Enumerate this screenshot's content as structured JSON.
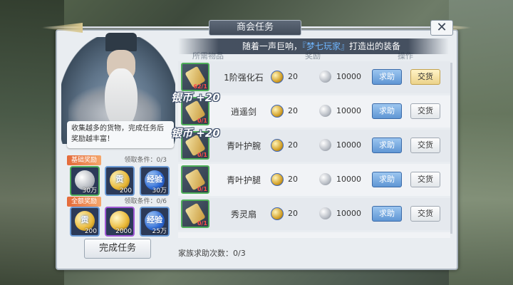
{
  "window": {
    "title": "商会任务",
    "close_label": "✕"
  },
  "announcement": {
    "prefix": "随着一声巨响，",
    "name": "『梦七玩家』",
    "suffix": "打造出的装备"
  },
  "table_headers": {
    "item": "所需物品",
    "reward": "奖励",
    "action": "操作"
  },
  "npc": {
    "speech": "收集越多的货物，完成任务后奖励越丰富！"
  },
  "basic_reward": {
    "tag": "基础奖励",
    "condition": "领取条件：0/3",
    "items": [
      {
        "icon": "silver-coin-icon",
        "label": "30万",
        "inner": ""
      },
      {
        "icon": "contribution-icon",
        "label": "200",
        "inner": "贡"
      },
      {
        "icon": "experience-icon",
        "label": "30万",
        "inner": "经验"
      }
    ]
  },
  "full_reward": {
    "tag": "全额奖励",
    "condition": "领取条件：0/6",
    "items": [
      {
        "icon": "contribution-icon",
        "label": "200",
        "inner": "贡"
      },
      {
        "icon": "gold-coin-icon",
        "label": "2000",
        "inner": ""
      },
      {
        "icon": "experience-icon",
        "label": "25万",
        "inner": "经验"
      }
    ]
  },
  "tasks": [
    {
      "name": "1阶强化石",
      "count": "62/1",
      "contribution": "20",
      "silver": "10000",
      "help": "求助",
      "give": "交货",
      "give_highlight": true
    },
    {
      "name": "逍遥剑",
      "count": "0/1",
      "contribution": "20",
      "silver": "10000",
      "help": "求助",
      "give": "交货",
      "give_highlight": false
    },
    {
      "name": "青叶护腕",
      "count": "0/1",
      "contribution": "20",
      "silver": "10000",
      "help": "求助",
      "give": "交货",
      "give_highlight": false
    },
    {
      "name": "青叶护腿",
      "count": "0/1",
      "contribution": "20",
      "silver": "10000",
      "help": "求助",
      "give": "交货",
      "give_highlight": false
    },
    {
      "name": "秀灵扇",
      "count": "0/1",
      "contribution": "20",
      "silver": "10000",
      "help": "求助",
      "give": "交货",
      "give_highlight": false
    }
  ],
  "floating_texts": [
    "银币 +20",
    "银币 +20"
  ],
  "complete_button": "完成任务",
  "family_help": "家族求助次数：0/3"
}
